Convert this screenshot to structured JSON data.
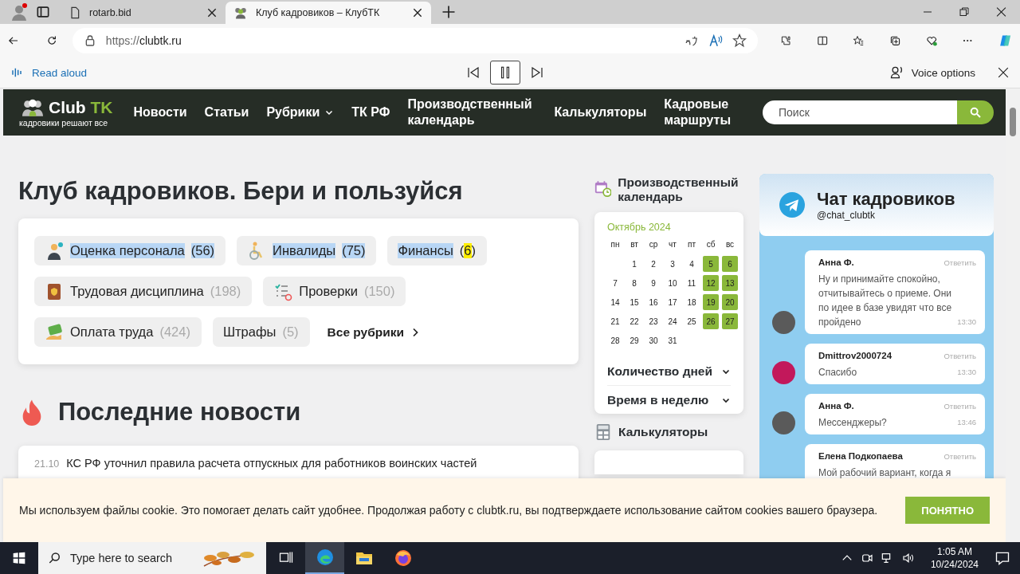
{
  "browser": {
    "tabs": [
      {
        "title": "rotarb.bid",
        "selected": false
      },
      {
        "title": "Клуб кадровиков – КлубТК",
        "selected": true
      }
    ],
    "address": {
      "scheme": "https://",
      "host": "clubtk.ru"
    },
    "read_aloud": {
      "label": "Read aloud",
      "voice_options": "Voice options"
    }
  },
  "site_header": {
    "logo": {
      "word": "Club",
      "accent": "TK",
      "tagline": "кадровики решают все"
    },
    "nav": [
      {
        "label": "Новости",
        "has_menu": false
      },
      {
        "label": "Статьи",
        "has_menu": false
      },
      {
        "label": "Рубрики",
        "has_menu": true
      },
      {
        "label": "ТК РФ",
        "has_menu": false
      },
      {
        "label": "Производственный календарь",
        "has_menu": false
      },
      {
        "label": "Калькуляторы",
        "has_menu": false
      },
      {
        "label": "Кадровые маршруты",
        "has_menu": false
      }
    ],
    "search": {
      "placeholder": "Поиск"
    }
  },
  "page": {
    "title": "Клуб кадровиков. Бери и пользуйся",
    "rubrics": [
      {
        "label": "Оценка персонала",
        "count": "(56)",
        "highlighted": true,
        "find_match": false
      },
      {
        "label": "Инвалиды",
        "count": "(75)",
        "highlighted": true,
        "find_match": false
      },
      {
        "label": "Финансы",
        "count": "(6)",
        "highlighted": true,
        "find_match": true
      },
      {
        "label": "Трудовая дисциплина",
        "count": "(198)",
        "highlighted": false,
        "find_match": false
      },
      {
        "label": "Проверки",
        "count": "(150)",
        "highlighted": false,
        "find_match": false
      },
      {
        "label": "Оплата труда",
        "count": "(424)",
        "highlighted": false,
        "find_match": false
      },
      {
        "label": "Штрафы",
        "count": "(5)",
        "highlighted": false,
        "find_match": false
      }
    ],
    "all_rubrics": "Все рубрики",
    "news_title": "Последние новости",
    "news": [
      {
        "date": "21.10",
        "title": "КС РФ уточнил правила расчета отпускных для работников воинских частей"
      }
    ]
  },
  "calendar": {
    "title": "Производственный календарь",
    "month": "Октябрь 2024",
    "weekdays": [
      "пн",
      "вт",
      "ср",
      "чт",
      "пт",
      "сб",
      "вс"
    ],
    "weeks": [
      [
        {
          "day": "1",
          "holiday": false
        },
        {
          "day": "2",
          "holiday": false
        },
        {
          "day": "3",
          "holiday": false
        },
        {
          "day": "4",
          "holiday": false
        },
        {
          "day": "5",
          "holiday": true
        },
        {
          "day": "6",
          "holiday": true
        }
      ],
      [
        {
          "day": "7",
          "holiday": false
        },
        {
          "day": "8",
          "holiday": false
        },
        {
          "day": "9",
          "holiday": false
        },
        {
          "day": "10",
          "holiday": false
        },
        {
          "day": "11",
          "holiday": false
        },
        {
          "day": "12",
          "holiday": true
        },
        {
          "day": "13",
          "holiday": true
        }
      ],
      [
        {
          "day": "14",
          "holiday": false
        },
        {
          "day": "15",
          "holiday": false
        },
        {
          "day": "16",
          "holiday": false
        },
        {
          "day": "17",
          "holiday": false
        },
        {
          "day": "18",
          "holiday": false
        },
        {
          "day": "19",
          "holiday": true
        },
        {
          "day": "20",
          "holiday": true
        }
      ],
      [
        {
          "day": "21",
          "holiday": false
        },
        {
          "day": "22",
          "holiday": false
        },
        {
          "day": "23",
          "holiday": false
        },
        {
          "day": "24",
          "holiday": false
        },
        {
          "day": "25",
          "holiday": false
        },
        {
          "day": "26",
          "holiday": true
        },
        {
          "day": "27",
          "holiday": true
        }
      ],
      [
        {
          "day": "28",
          "holiday": false
        },
        {
          "day": "29",
          "holiday": false
        },
        {
          "day": "30",
          "holiday": false
        },
        {
          "day": "31",
          "holiday": false
        }
      ]
    ],
    "sections": [
      {
        "label": "Количество дней",
        "expanded": false
      },
      {
        "label": "Время в неделю",
        "expanded": false
      }
    ],
    "calculators_title": "Калькуляторы"
  },
  "chat": {
    "title": "Чат кадровиков",
    "handle": "@chat_clubtk",
    "messages": [
      {
        "author": "Анна Ф.",
        "text": "Ну и принимайте спокойно, отчитывайтесь о приеме. Они по идее в базе увидят что все пройдено",
        "time": "13:30",
        "reply": "Ответить",
        "color": "#5a5a5a"
      },
      {
        "author": "Dmittrov2000724",
        "text": "Спасибо",
        "time": "13:30",
        "reply": "Ответить",
        "color": "#c2185b"
      },
      {
        "author": "Анна Ф.",
        "text": "Мессенджеры?",
        "time": "13:46",
        "reply": "Ответить",
        "color": "#5a5a5a"
      },
      {
        "author": "Елена Подкопаева",
        "text": "Мой рабочий вариант, когда я",
        "reply": "Ответить"
      }
    ]
  },
  "cookie_banner": {
    "text": "Мы используем файлы cookie. Это помогает делать сайт удобнее. Продолжая работу с clubtk.ru, вы подтверждаете использование сайтом cookies вашего браузера.",
    "button": "ПОНЯТНО"
  },
  "taskbar": {
    "search_placeholder": "Type here to search",
    "time": "1:05 AM",
    "date": "10/24/2024"
  }
}
